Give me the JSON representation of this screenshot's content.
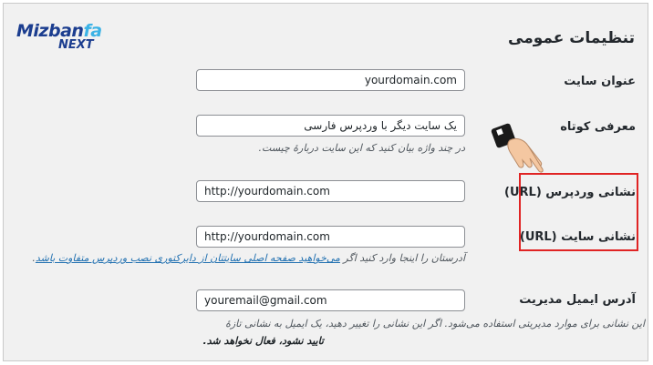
{
  "brand": {
    "logo_main": "Mizban",
    "logo_accent": "fa",
    "logo_sub": "NEXT"
  },
  "page": {
    "title": "تنظیمات عمومی"
  },
  "fields": {
    "site_title": {
      "label": "عنوان سایت",
      "value": "yourdomain.com"
    },
    "tagline": {
      "label": "معرفی کوتاه",
      "value": "یک سایت دیگر با وردپرس فارسی",
      "description": "در چند واژه بیان کنید که این سایت درباره‌ٔ چیست."
    },
    "wp_address": {
      "label": "نشانی وردپرس (URL)",
      "value": "http://yourdomain.com"
    },
    "site_address": {
      "label": "نشانی سایت (URL)",
      "value": "http://yourdomain.com",
      "description_start": "آدرستان را اینجا وارد کنید اگر ",
      "description_link": "می‌خواهید صفحه اصلی سایتتان از دایرکتوری نصب وردپرس متفاوت باشد",
      "description_end": "."
    },
    "admin_email": {
      "label": "آدرس ایمیل مدیریت",
      "value": "youremail@gmail.com",
      "description_line1": "این نشانی برای موارد مدیریتی استفاده می‌شود. اگر این نشانی را تغییر دهید، یک ایمیل به نشانی تازهٔ",
      "description_line2": "تایید نشود، فعال نخواهد شد."
    }
  },
  "icons": {
    "pointer": "pointing-hand-icon"
  },
  "colors": {
    "highlight": "#e02424",
    "link": "#2271b1",
    "background": "#f1f1f1"
  }
}
